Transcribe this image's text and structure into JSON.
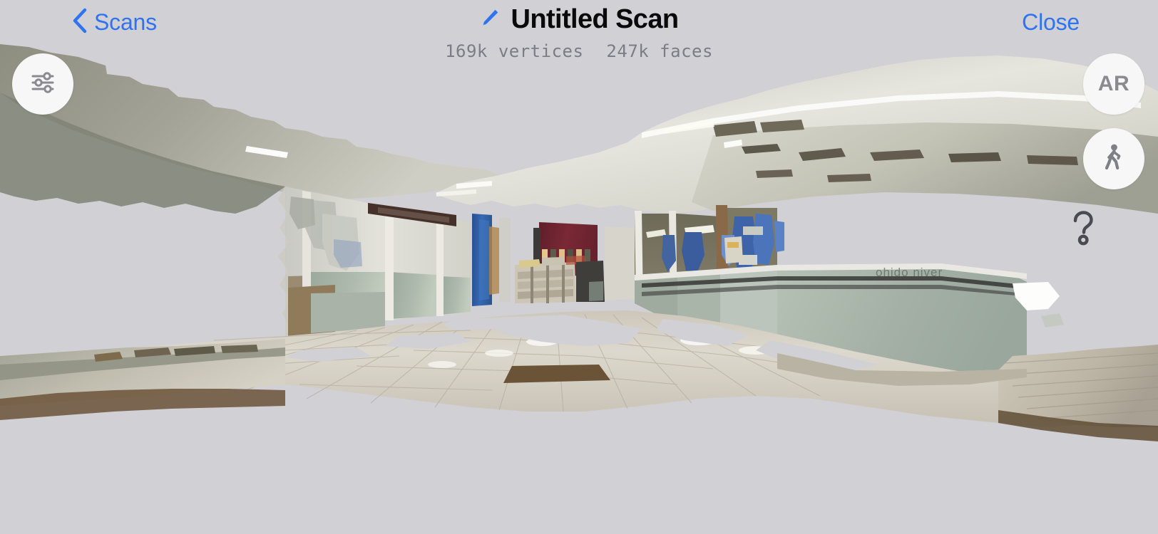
{
  "app": {
    "background_color": "#d0d0d5",
    "accent_color": "#2f73f0"
  },
  "header": {
    "back_label": "Scans",
    "back_icon": "chevron-left-icon",
    "title": "Untitled Scan",
    "title_edit_icon": "pencil-icon",
    "close_label": "Close",
    "stats": {
      "vertices": "169k vertices",
      "faces": "247k faces"
    }
  },
  "controls": {
    "settings": {
      "icon": "sliders-icon",
      "label": ""
    },
    "ar": {
      "icon": "ar-icon",
      "label": "AR"
    },
    "walk": {
      "icon": "walking-person-icon",
      "label": ""
    },
    "help": {
      "icon": "question-mark-icon",
      "label": ""
    }
  },
  "viewport": {
    "name": "3d-mesh-viewport",
    "scene_description": "Textured photogrammetry mesh of an indoor shopping arcade corridor viewed down its length, with ragged unscanned holes in the ceiling, floor and walls.",
    "palette": {
      "background": "#d0d0d5",
      "ceiling_light": "#e9e8e2",
      "ceiling_shadow": "#8f9083",
      "wall_white": "#e4e3dd",
      "glass_green": "#a8b5ab",
      "floor_tile": "#d8d3c8",
      "floor_tile_dark": "#b9b2a4",
      "floor_mat_brown": "#6b5338",
      "door_blue": "#2c5fa8",
      "back_wall_maroon": "#6e2430",
      "sign_brown": "#46302a",
      "mannequin_blue": "#4a72b8",
      "wood_column": "#8a6a46"
    },
    "glass_text": "ohido  niver"
  }
}
